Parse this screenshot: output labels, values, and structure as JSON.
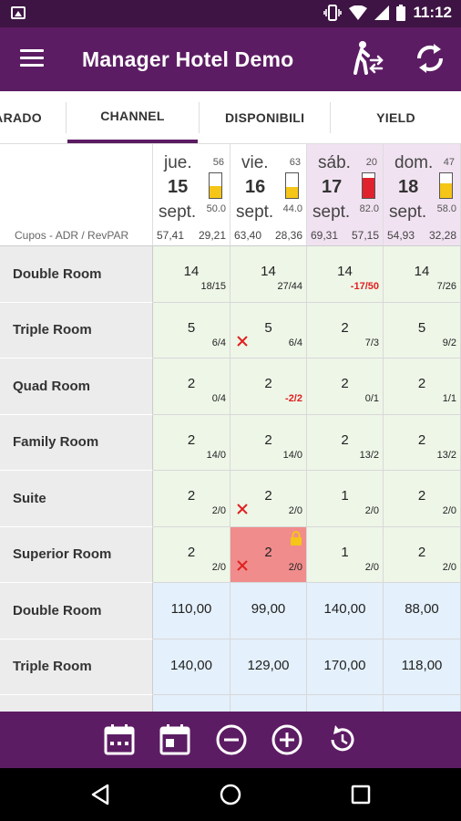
{
  "status": {
    "time": "11:12"
  },
  "app": {
    "title": "Manager Hotel Demo"
  },
  "tabs": [
    {
      "label": "ARADO"
    },
    {
      "label": "CHANNEL"
    },
    {
      "label": "DISPONIBILI"
    },
    {
      "label": "YIELD"
    }
  ],
  "corner_label": "Cupos - ADR / RevPAR",
  "days": [
    {
      "dow": "jue.",
      "day": "15",
      "mon": "sept.",
      "occ": "56",
      "pct": "50.0",
      "fill": 0.5,
      "fill_color": "#f5c518",
      "adr": "57,41",
      "revpar": "29,21",
      "weekend": false
    },
    {
      "dow": "vie.",
      "day": "16",
      "mon": "sept.",
      "occ": "63",
      "pct": "44.0",
      "fill": 0.44,
      "fill_color": "#f5c518",
      "adr": "63,40",
      "revpar": "28,36",
      "weekend": false
    },
    {
      "dow": "sáb.",
      "day": "17",
      "mon": "sept.",
      "occ": "20",
      "pct": "82.0",
      "fill": 0.82,
      "fill_color": "#e0222e",
      "adr": "69,31",
      "revpar": "57,15",
      "weekend": true
    },
    {
      "dow": "dom.",
      "day": "18",
      "mon": "sept.",
      "occ": "47",
      "pct": "58.0",
      "fill": 0.58,
      "fill_color": "#f5c518",
      "adr": "54,93",
      "revpar": "32,28",
      "weekend": true
    }
  ],
  "quota_rows": [
    {
      "name": "Double Room",
      "cells": [
        {
          "main": "14",
          "sub": "18/15",
          "neg": false,
          "x": false,
          "lock": false,
          "red": false
        },
        {
          "main": "14",
          "sub": "27/44",
          "neg": false,
          "x": false,
          "lock": false,
          "red": false
        },
        {
          "main": "14",
          "sub": "-17/50",
          "neg": true,
          "x": false,
          "lock": false,
          "red": false
        },
        {
          "main": "14",
          "sub": "7/26",
          "neg": false,
          "x": false,
          "lock": false,
          "red": false
        }
      ]
    },
    {
      "name": "Triple Room",
      "cells": [
        {
          "main": "5",
          "sub": "6/4",
          "neg": false,
          "x": false,
          "lock": false,
          "red": false
        },
        {
          "main": "5",
          "sub": "6/4",
          "neg": false,
          "x": true,
          "lock": false,
          "red": false
        },
        {
          "main": "2",
          "sub": "7/3",
          "neg": false,
          "x": false,
          "lock": false,
          "red": false
        },
        {
          "main": "5",
          "sub": "9/2",
          "neg": false,
          "x": false,
          "lock": false,
          "red": false
        }
      ]
    },
    {
      "name": "Quad Room",
      "cells": [
        {
          "main": "2",
          "sub": "0/4",
          "neg": false,
          "x": false,
          "lock": false,
          "red": false
        },
        {
          "main": "2",
          "sub": "-2/2",
          "neg": true,
          "x": false,
          "lock": false,
          "red": false
        },
        {
          "main": "2",
          "sub": "0/1",
          "neg": false,
          "x": false,
          "lock": false,
          "red": false
        },
        {
          "main": "2",
          "sub": "1/1",
          "neg": false,
          "x": false,
          "lock": false,
          "red": false
        }
      ]
    },
    {
      "name": "Family Room",
      "cells": [
        {
          "main": "2",
          "sub": "14/0",
          "neg": false,
          "x": false,
          "lock": false,
          "red": false
        },
        {
          "main": "2",
          "sub": "14/0",
          "neg": false,
          "x": false,
          "lock": false,
          "red": false
        },
        {
          "main": "2",
          "sub": "13/2",
          "neg": false,
          "x": false,
          "lock": false,
          "red": false
        },
        {
          "main": "2",
          "sub": "13/2",
          "neg": false,
          "x": false,
          "lock": false,
          "red": false
        }
      ]
    },
    {
      "name": "Suite",
      "cells": [
        {
          "main": "2",
          "sub": "2/0",
          "neg": false,
          "x": false,
          "lock": false,
          "red": false
        },
        {
          "main": "2",
          "sub": "2/0",
          "neg": false,
          "x": true,
          "lock": false,
          "red": false
        },
        {
          "main": "1",
          "sub": "2/0",
          "neg": false,
          "x": false,
          "lock": false,
          "red": false
        },
        {
          "main": "2",
          "sub": "2/0",
          "neg": false,
          "x": false,
          "lock": false,
          "red": false
        }
      ]
    },
    {
      "name": "Superior Room",
      "cells": [
        {
          "main": "2",
          "sub": "2/0",
          "neg": false,
          "x": false,
          "lock": false,
          "red": false
        },
        {
          "main": "2",
          "sub": "2/0",
          "neg": false,
          "x": true,
          "lock": true,
          "red": true
        },
        {
          "main": "1",
          "sub": "2/0",
          "neg": false,
          "x": false,
          "lock": false,
          "red": false
        },
        {
          "main": "2",
          "sub": "2/0",
          "neg": false,
          "x": false,
          "lock": false,
          "red": false
        }
      ]
    }
  ],
  "price_rows": [
    {
      "name": "Double Room",
      "prices": [
        "110,00",
        "99,00",
        "140,00",
        "88,00"
      ]
    },
    {
      "name": "Triple Room",
      "prices": [
        "140,00",
        "129,00",
        "170,00",
        "118,00"
      ]
    }
  ],
  "bottom_icons": [
    "calendar-week-icon",
    "calendar-day-icon",
    "minus-circle-icon",
    "plus-circle-icon",
    "restore-icon"
  ],
  "colors": {
    "primary": "#5c1c63",
    "status": "#3e1444",
    "cell_green": "#eef6e8",
    "cell_blue": "#e4f0fb",
    "cell_red": "#f08c8c",
    "weekend": "#f1e2f1"
  }
}
